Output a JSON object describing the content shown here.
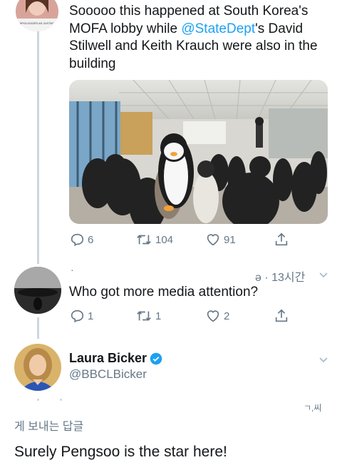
{
  "tweet1": {
    "text_lines": [
      "Sooooo this happened at South Korea's",
      "",
      "Stilwell and Keith Krauch were also in the",
      "building"
    ],
    "line2_before": "MOFA lobby while ",
    "line2_link": "@StateDept",
    "line2_after": "'s David",
    "avatar_caption": "\"APOLOGIZES AS JUSTM\"",
    "replies": "6",
    "retweets": "104",
    "likes": "91"
  },
  "tweet2": {
    "dot": "·",
    "meta": "ə · 13시간",
    "text": "Who got more media attention?",
    "replies": "1",
    "retweets": "1",
    "likes": "2"
  },
  "profile": {
    "name": "Laura Bicker",
    "handle": "@BBCLBicker",
    "side_glyph": "ㄱ,씨"
  },
  "reply_box": {
    "label": "게 보내는 답글",
    "text": "Surely Pengsoo is the star here!"
  },
  "colors": {
    "accent": "#1da1f2",
    "muted": "#657786",
    "line": "#ccd6dd"
  }
}
